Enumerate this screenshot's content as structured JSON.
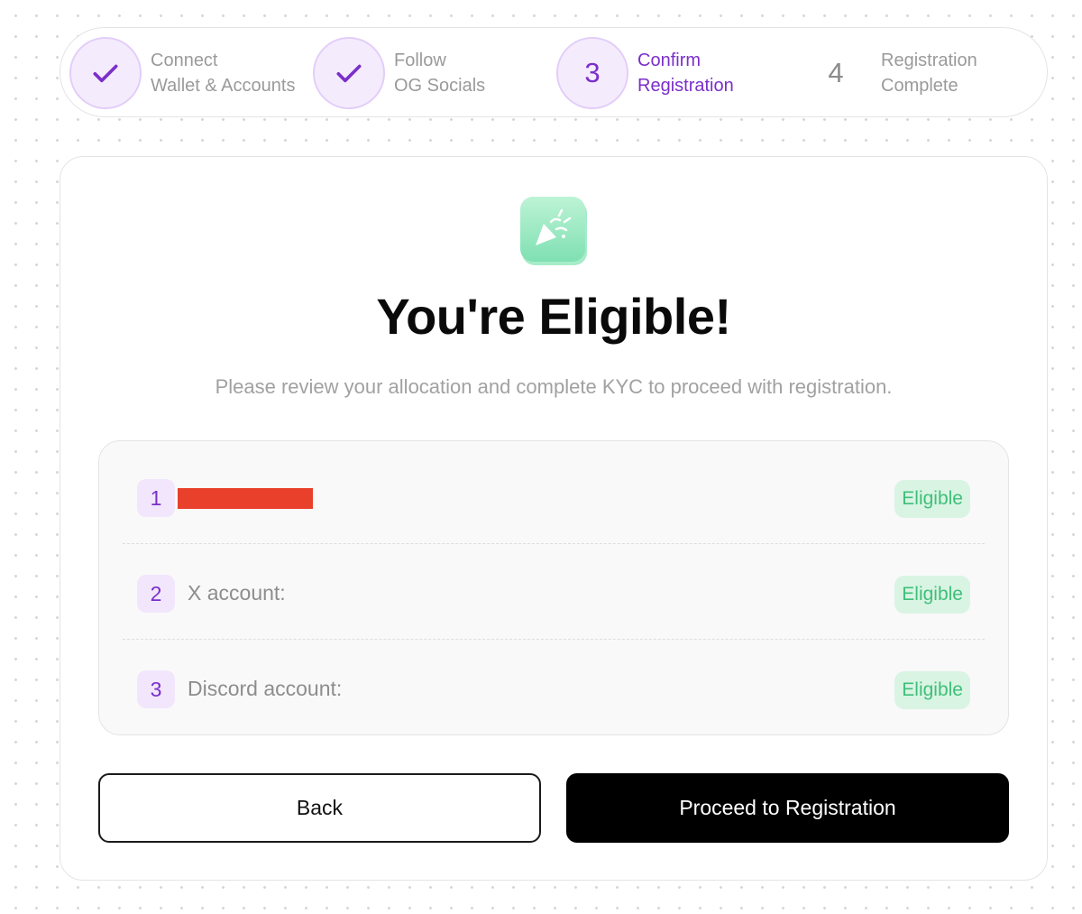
{
  "stepper": {
    "steps": [
      {
        "marker": "check-icon",
        "line1": "Connect",
        "line2": "Wallet & Accounts",
        "state": "done"
      },
      {
        "marker": "check-icon",
        "line1": "Follow",
        "line2": "OG Socials",
        "state": "done"
      },
      {
        "number": "3",
        "line1": "Confirm",
        "line2": "Registration",
        "state": "active"
      },
      {
        "number": "4",
        "line1": "Registration",
        "line2": "Complete",
        "state": "pending"
      }
    ]
  },
  "main": {
    "icon": "party-popper-icon",
    "title": "You're Eligible!",
    "subtitle": "Please review your allocation and complete KYC to proceed with registration.",
    "rows": [
      {
        "number": "1",
        "label": "",
        "redacted": true,
        "status": "Eligible"
      },
      {
        "number": "2",
        "label": "X account:",
        "status": "Eligible"
      },
      {
        "number": "3",
        "label": "Discord account:",
        "status": "Eligible"
      }
    ],
    "back_label": "Back",
    "proceed_label": "Proceed to Registration"
  },
  "colors": {
    "accent": "#7b2fc9",
    "eligible_text": "#3fbf79",
    "eligible_bg": "#d9f4e3",
    "redaction": "#e8402a",
    "primary_button": "#000000"
  }
}
